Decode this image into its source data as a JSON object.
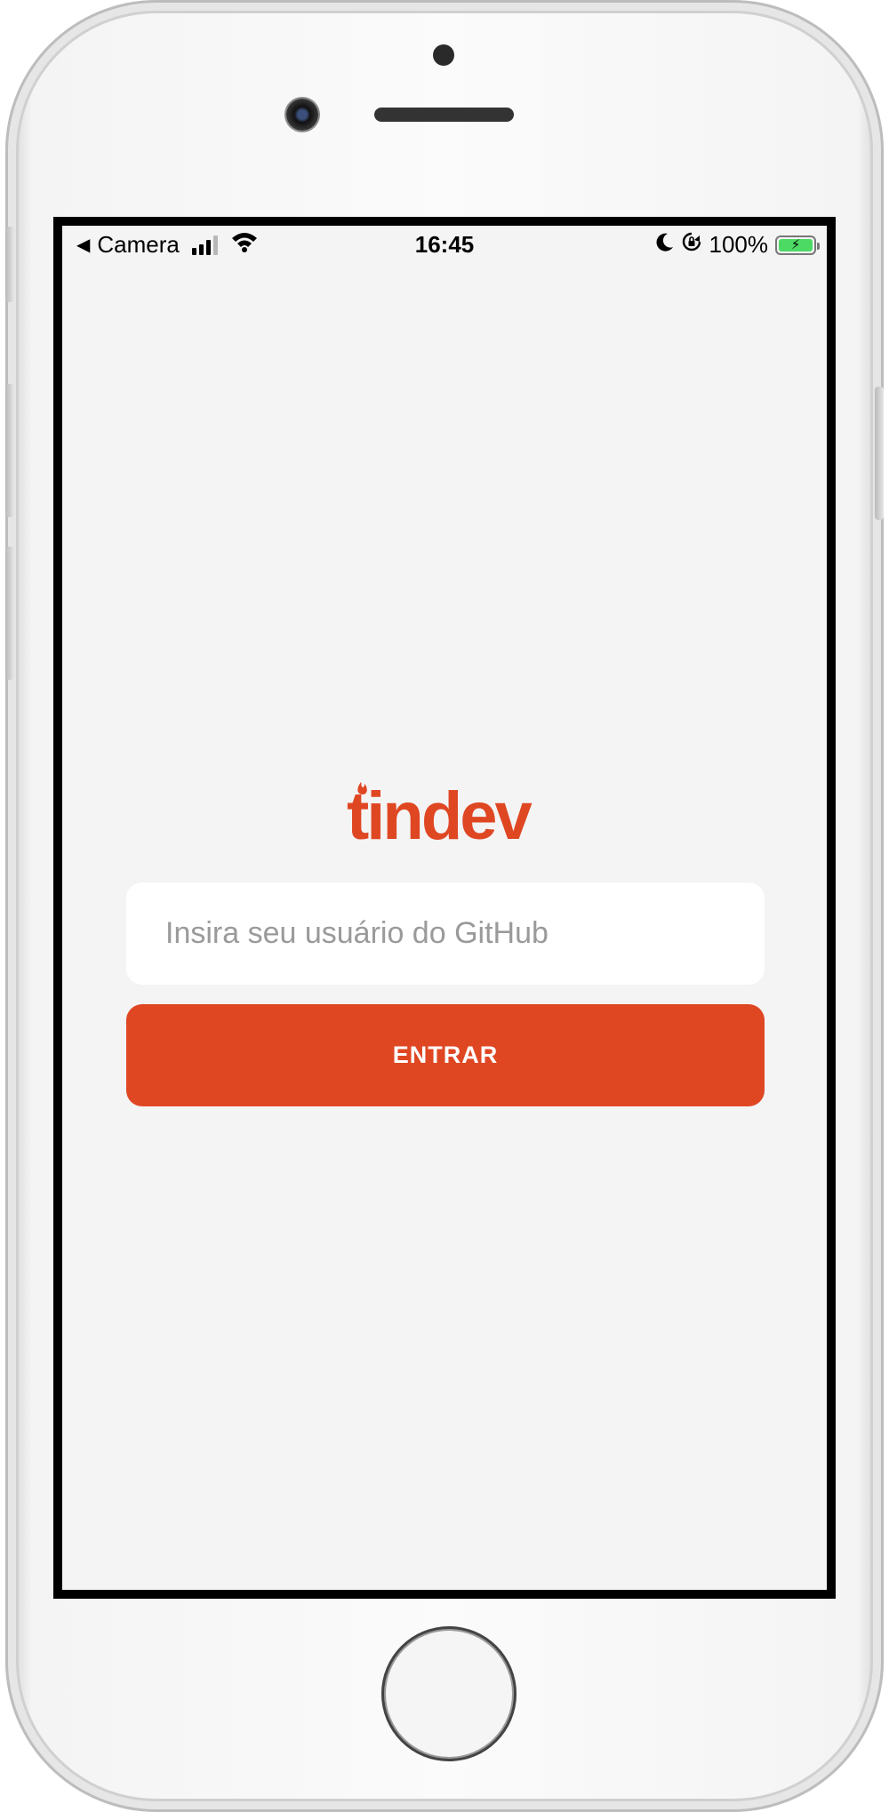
{
  "status_bar": {
    "back_label": "Camera",
    "time": "16:45",
    "battery_percent": "100%",
    "battery_level": 1.0,
    "battery_charging": true,
    "icons": [
      "back-arrow-icon",
      "signal-icon",
      "wifi-icon",
      "moon-icon",
      "rotation-lock-icon",
      "battery-icon"
    ]
  },
  "logo": {
    "text": "tindev",
    "color": "#df4723"
  },
  "login": {
    "username_value": "",
    "username_placeholder": "Insira seu usuário do GitHub",
    "submit_label": "ENTRAR",
    "accent_color": "#df4723"
  }
}
